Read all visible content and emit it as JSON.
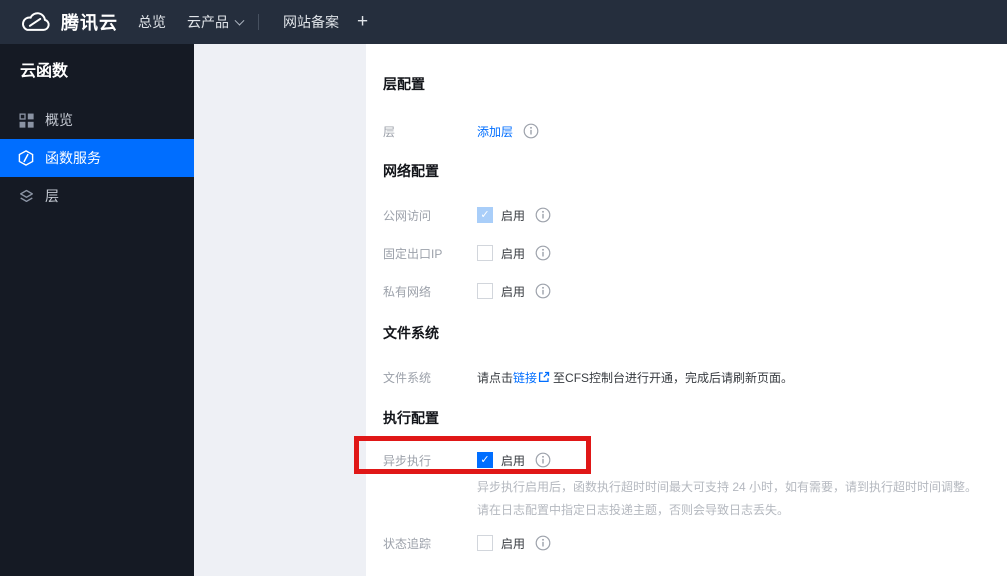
{
  "topbar": {
    "brand": "腾讯云",
    "nav_overview": "总览",
    "nav_products": "云产品",
    "nav_beian": "网站备案",
    "nav_add": "+"
  },
  "sidebar": {
    "title": "云函数",
    "overview": "概览",
    "services": "函数服务",
    "layers": "层"
  },
  "sections": {
    "layer": {
      "title": "层配置",
      "label": "层",
      "add_link": "添加层"
    },
    "network": {
      "title": "网络配置",
      "rows": [
        {
          "label": "公网访问",
          "value": "启用",
          "state": "checked-disabled"
        },
        {
          "label": "固定出口IP",
          "value": "启用",
          "state": "unchecked"
        },
        {
          "label": "私有网络",
          "value": "启用",
          "state": "unchecked"
        }
      ]
    },
    "filesystem": {
      "title": "文件系统",
      "label": "文件系统",
      "text_before": "请点击",
      "link": "链接",
      "text_after": "至CFS控制台进行开通，完成后请刷新页面。"
    },
    "execution": {
      "title": "执行配置",
      "async": {
        "label": "异步执行",
        "value": "启用",
        "state": "checked"
      },
      "desc_line1": "异步执行启用后，函数执行超时时间最大可支持 24 小时，如有需要，请到执行超时时间调整。",
      "desc_line2": "请在日志配置中指定日志投递主题，否则会导致日志丢失。",
      "trace": {
        "label": "状态追踪",
        "value": "启用",
        "state": "unchecked"
      }
    }
  },
  "colors": {
    "accent_blue": "#006eff",
    "disabled_check_blue": "#a9cef9",
    "annotation_red": "#e01717",
    "topbar_bg": "#252e3d",
    "sidebar_bg": "#151a24",
    "panel_bg": "#eef0f5"
  }
}
